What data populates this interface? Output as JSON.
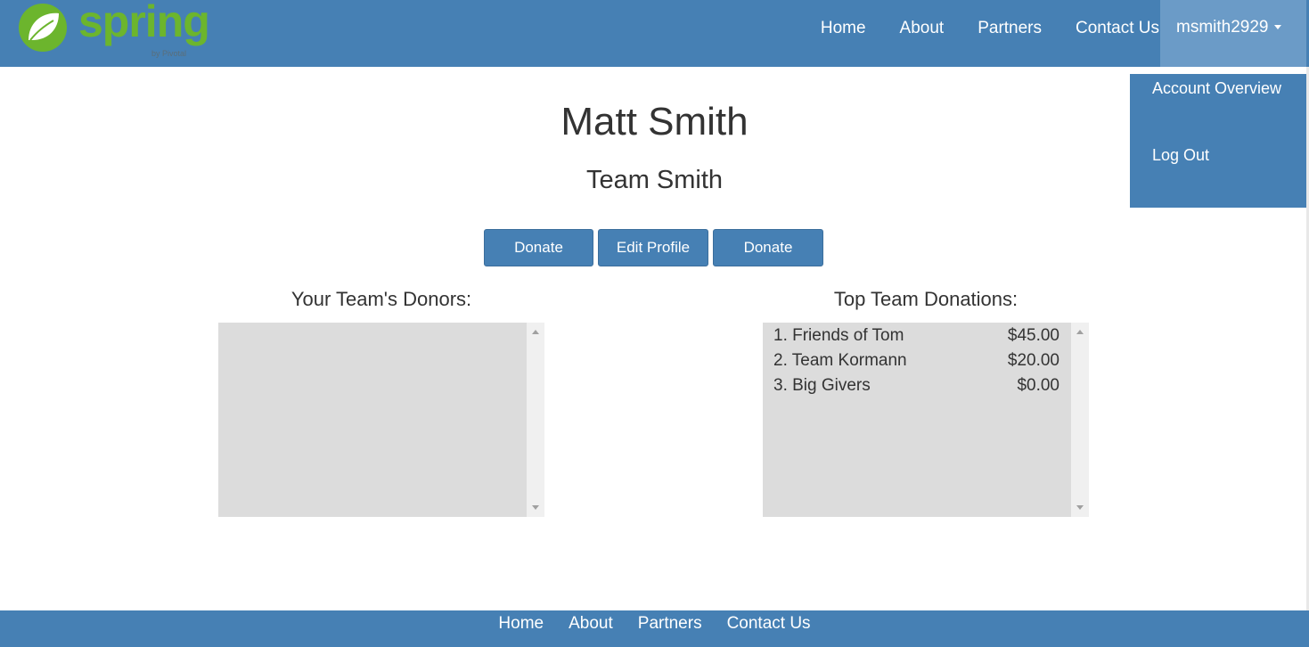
{
  "brand": {
    "name": "spring",
    "sub": "by Pivotal",
    "logo_color": "#6cb52d"
  },
  "nav": {
    "links": [
      "Home",
      "About",
      "Partners",
      "Contact Us"
    ],
    "user": "msmith2929"
  },
  "dropdown": {
    "items": [
      "Account Overview",
      "Log Out"
    ]
  },
  "profile": {
    "name": "Matt Smith",
    "team": "Team Smith"
  },
  "buttons": {
    "donate_left": "Donate",
    "edit_profile": "Edit Profile",
    "donate_right": "Donate"
  },
  "donors": {
    "heading": "Your Team's Donors:",
    "items": []
  },
  "top_donations": {
    "heading": "Top Team Donations:",
    "items": [
      {
        "label": "1. Friends of Tom",
        "amount": "$45.00"
      },
      {
        "label": "2. Team Kormann",
        "amount": "$20.00"
      },
      {
        "label": "3. Big Givers",
        "amount": "$0.00"
      }
    ]
  },
  "footer": {
    "links": [
      "Home",
      "About",
      "Partners",
      "Contact Us"
    ]
  },
  "colors": {
    "primary": "#4680b4",
    "active_menu": "#6b9bc7",
    "list_bg": "#dcdcdc"
  }
}
